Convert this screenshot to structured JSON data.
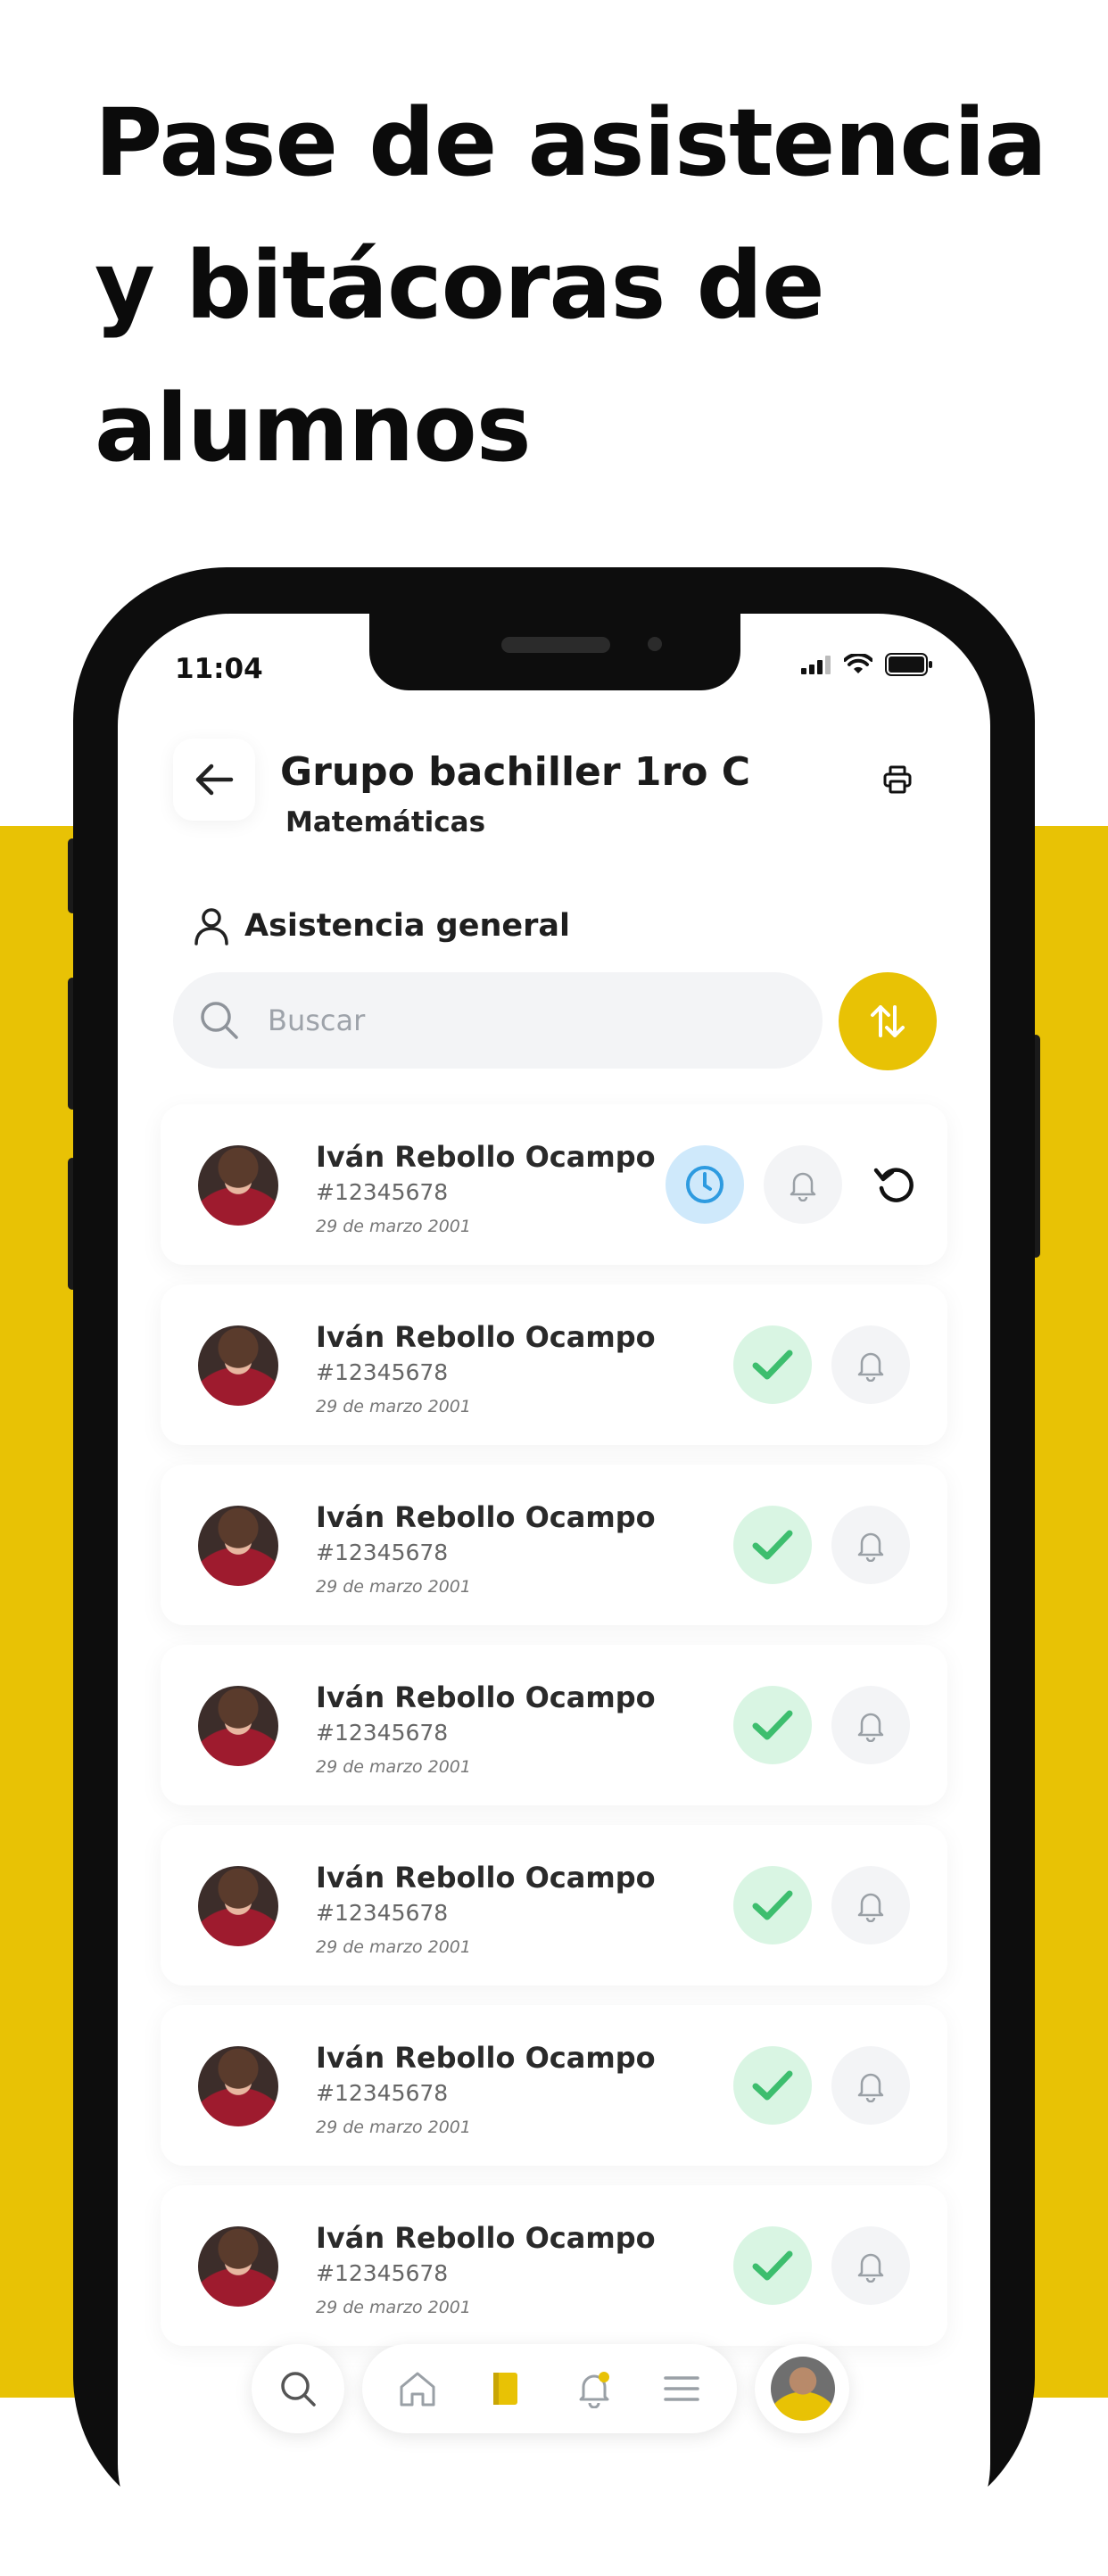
{
  "headline": {
    "line1": "Pase de asistencia",
    "line2": "y bitácoras de",
    "line3": "alumnos"
  },
  "colors": {
    "accent": "#E8C205",
    "success": "#3DBE6E",
    "info": "#2E9BE0"
  },
  "status_bar": {
    "time": "11:04"
  },
  "header": {
    "title": "Grupo bachiller 1ro C",
    "subtitle": "Matemáticas",
    "back_icon": "arrow-left-icon",
    "print_icon": "printer-icon"
  },
  "section": {
    "label": "Asistencia general",
    "icon": "user-icon"
  },
  "search": {
    "placeholder": "Buscar",
    "value": ""
  },
  "students": [
    {
      "name": "Iván Rebollo Ocampo",
      "id": "#12345678",
      "date": "29 de marzo 2001",
      "status": "pending"
    },
    {
      "name": "Iván Rebollo Ocampo",
      "id": "#12345678",
      "date": "29 de marzo 2001",
      "status": "present"
    },
    {
      "name": "Iván Rebollo Ocampo",
      "id": "#12345678",
      "date": "29 de marzo 2001",
      "status": "present"
    },
    {
      "name": "Iván Rebollo Ocampo",
      "id": "#12345678",
      "date": "29 de marzo 2001",
      "status": "present"
    },
    {
      "name": "Iván Rebollo Ocampo",
      "id": "#12345678",
      "date": "29 de marzo 2001",
      "status": "present"
    },
    {
      "name": "Iván Rebollo Ocampo",
      "id": "#12345678",
      "date": "29 de marzo 2001",
      "status": "present"
    },
    {
      "name": "Iván Rebollo Ocampo",
      "id": "#12345678",
      "date": "29 de marzo 2001",
      "status": "present"
    }
  ],
  "bottom_nav": [
    "search-icon",
    "home-icon",
    "book-icon",
    "bell-icon",
    "menu-icon",
    "avatar"
  ]
}
